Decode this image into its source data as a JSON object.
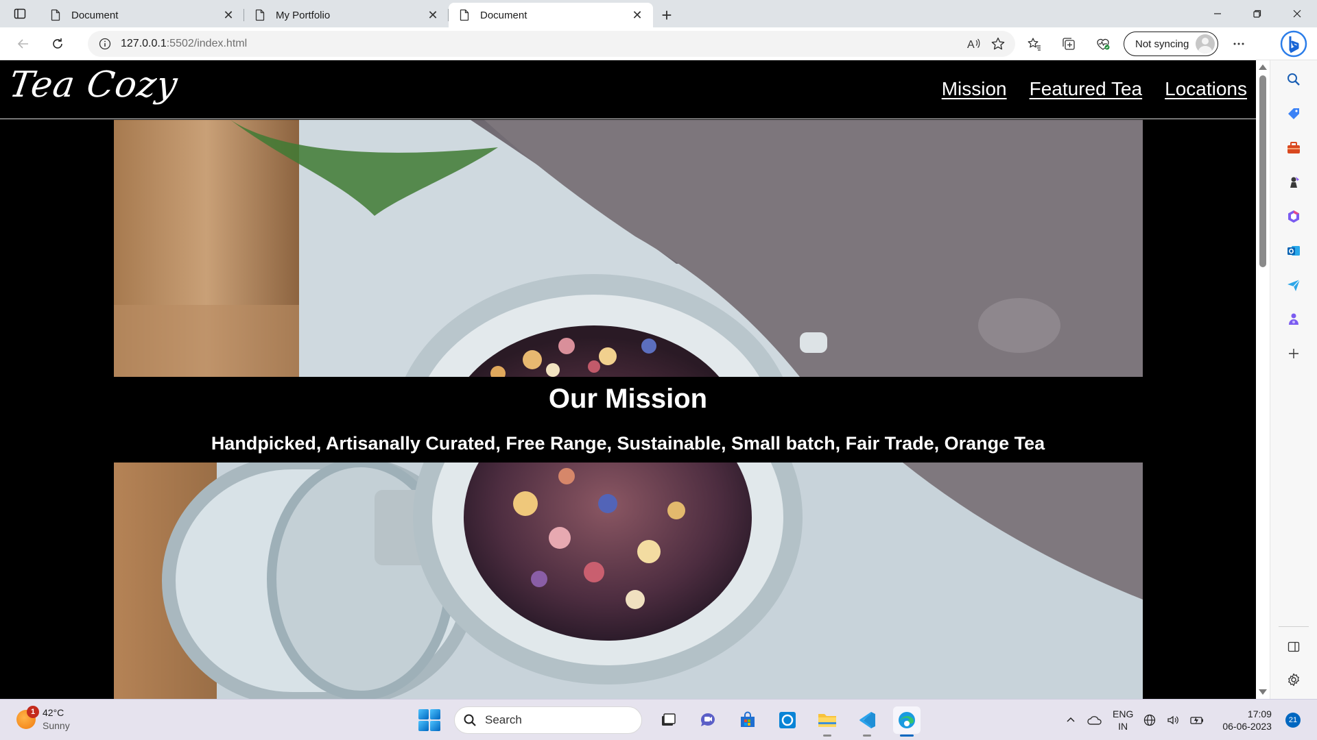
{
  "browser": {
    "tabs": [
      {
        "title": "Document",
        "active": false
      },
      {
        "title": "My Portfolio",
        "active": false
      },
      {
        "title": "Document",
        "active": true
      }
    ],
    "address": {
      "host": "127.0.0.1",
      "port_path": ":5502/index.html"
    },
    "sync_label": "Not syncing",
    "sidebar_icons": [
      "search-icon",
      "tag-icon",
      "toolbox-icon",
      "games-icon",
      "office-icon",
      "outlook-icon",
      "send-icon",
      "copilot-icon",
      "add-icon",
      "split-screen-icon",
      "settings-icon"
    ]
  },
  "site": {
    "logo": "Tea Cozy",
    "nav": {
      "mission": "Mission",
      "featured": "Featured Tea",
      "locations": "Locations"
    },
    "mission_title": "Our Mission",
    "mission_subtitle": "Handpicked, Artisanally Curated, Free Range, Sustainable, Small batch, Fair Trade, Orange Tea",
    "hero_description": "top-down photo of an open glass jar filled with colorful dried tea petals on a wooden table beside a grey knit blanket"
  },
  "taskbar": {
    "weather": {
      "temp": "42°C",
      "condition": "Sunny",
      "badge": "1"
    },
    "search_placeholder": "Search",
    "apps": [
      "task-view-icon",
      "chat-icon",
      "store-icon",
      "cortana-icon",
      "file-explorer-icon",
      "vscode-icon",
      "edge-icon"
    ],
    "lang": {
      "line1": "ENG",
      "line2": "IN"
    },
    "clock": {
      "time": "17:09",
      "date": "06-06-2023"
    },
    "notifications": "21"
  },
  "colors": {
    "page_bg": "#000000",
    "nav_text": "#ffffff",
    "accent": "#0067c0",
    "taskbar_bg": "#e6e3ee"
  }
}
